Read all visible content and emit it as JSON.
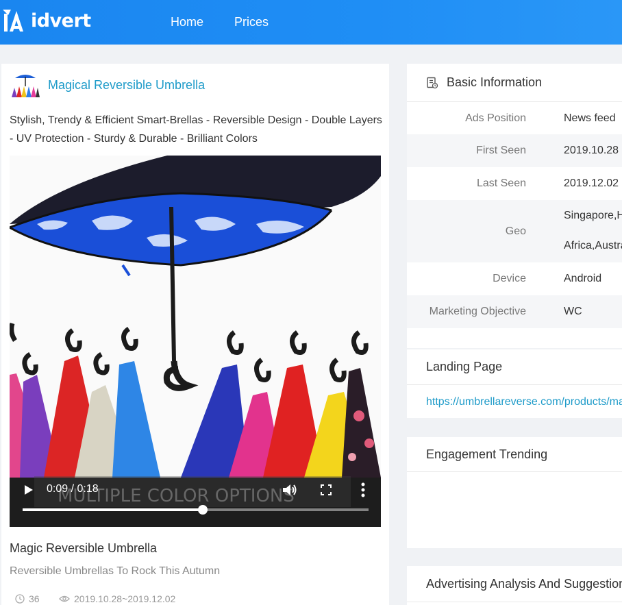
{
  "app": {
    "logo_text": "idvert",
    "nav": {
      "home": "Home",
      "prices": "Prices"
    }
  },
  "ad": {
    "advertiser": "Magical Reversible Umbrella",
    "text": "Stylish, Trendy & Efficient Smart-Brellas - Reversible Design - Double Layers - UV Protection - Sturdy & Durable - Brilliant Colors",
    "video": {
      "time": "0:09 / 0:18",
      "progress": 0.52,
      "overlay_text": "MULTIPLE COLOR OPTIONS"
    },
    "title": "Magic Reversible Umbrella",
    "subtitle": "Reversible Umbrellas To Rock This Autumn",
    "count": "36",
    "dates": "2019.10.28~2019.12.02"
  },
  "basic_info": {
    "heading": "Basic Information",
    "rows": [
      {
        "label": "Ads Position",
        "value": "News feed"
      },
      {
        "label": "First Seen",
        "value": "2019.10.28"
      },
      {
        "label": "Last Seen",
        "value": "2019.12.02"
      },
      {
        "label": "Geo",
        "value": "Singapore,H",
        "value2": "Africa,Austra"
      },
      {
        "label": "Device",
        "value": "Android"
      },
      {
        "label": "Marketing Objective",
        "value": "WC"
      }
    ]
  },
  "landing": {
    "heading": "Landing Page",
    "url": "https://umbrellareverse.com/products/ma"
  },
  "engagement": {
    "heading": "Engagement Trending"
  },
  "advertising": {
    "heading": "Advertising Analysis And Suggestion"
  },
  "colors": {
    "header_blue": "#1f8ef5",
    "link_teal": "#1e9bc9"
  }
}
